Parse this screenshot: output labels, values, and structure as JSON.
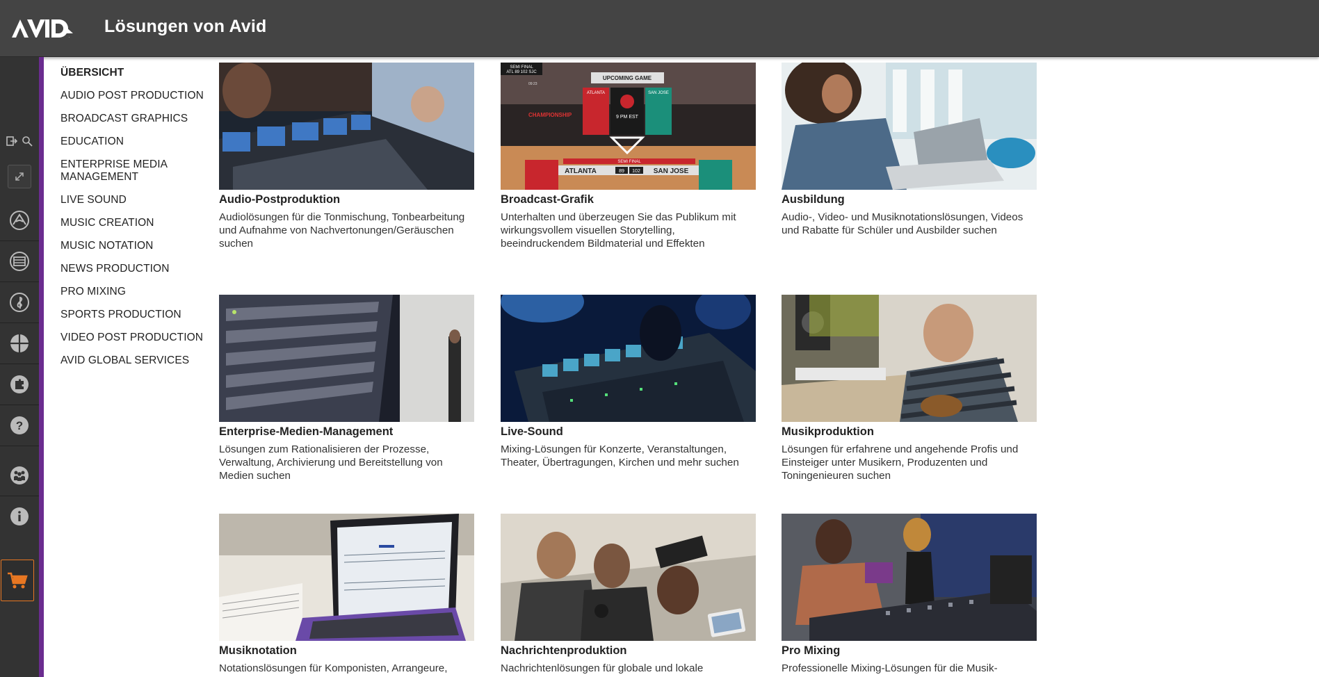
{
  "header": {
    "logo_text": "AVID",
    "title": "Lösungen von Avid"
  },
  "rail": {
    "tools": [
      "exit-icon",
      "search-icon"
    ],
    "expand_icon": "expand-icon",
    "items": [
      "avid-swoosh-icon",
      "film-icon",
      "treble-clef-icon",
      "globe-grid-icon",
      "puzzle-icon",
      "help-icon",
      "community-icon",
      "info-icon"
    ],
    "cart_icon": "cart-icon",
    "accent_color": "#6a2c8f",
    "cart_color": "#e87722"
  },
  "nav": {
    "items": [
      {
        "label": "ÜBERSICHT",
        "active": true
      },
      {
        "label": "AUDIO POST PRODUCTION"
      },
      {
        "label": "BROADCAST GRAPHICS"
      },
      {
        "label": "EDUCATION"
      },
      {
        "label": "ENTERPRISE MEDIA MANAGEMENT"
      },
      {
        "label": "LIVE SOUND"
      },
      {
        "label": "MUSIC CREATION"
      },
      {
        "label": "MUSIC NOTATION"
      },
      {
        "label": "NEWS PRODUCTION"
      },
      {
        "label": "PRO MIXING"
      },
      {
        "label": "SPORTS PRODUCTION"
      },
      {
        "label": "VIDEO POST PRODUCTION"
      },
      {
        "label": "AVID GLOBAL SERVICES"
      }
    ]
  },
  "cards": [
    {
      "title": "Audio-Postproduktion",
      "desc": "Audiolösungen für die Tonmischung, Tonbearbeitung und Aufnahme von Nachvertonungen/Geräuschen suchen"
    },
    {
      "title": "Broadcast-Grafik",
      "desc": "Unterhalten und überzeugen Sie das Publikum mit wirkungsvollem visuellen Storytelling, beeindruckendem Bildmaterial und Effekten",
      "graphic": {
        "top_left": "SEMI FINAL",
        "score_small": "ATL 89 102 SJC",
        "time_small": "09:23",
        "upcoming": "UPCOMING GAME",
        "team_left": "ATLANTA",
        "team_right": "SAN JOSE",
        "game_time": "9 PM EST",
        "banner": "CHAMPIONSHIP",
        "bottom_label": "SEMI FINAL",
        "bottom_left": "ATLANTA",
        "score_a": "89",
        "score_b": "102",
        "bottom_right": "SAN JOSE"
      }
    },
    {
      "title": "Ausbildung",
      "desc": "Audio-, Video- und Musiknotationslösungen, Videos und Rabatte für Schüler und Ausbilder suchen"
    },
    {
      "title": "Enterprise-Medien-Management",
      "desc": "Lösungen zum Rationalisieren der Prozesse, Verwaltung, Archivierung und Bereitstellung von Medien suchen"
    },
    {
      "title": "Live-Sound",
      "desc": "Mixing-Lösungen für Konzerte, Veranstaltungen, Theater, Übertragungen, Kirchen und mehr suchen"
    },
    {
      "title": "Musikproduktion",
      "desc": "Lösungen für erfahrene und angehende Profis und Einsteiger unter Musikern, Produzenten und Toningenieuren suchen"
    },
    {
      "title": "Musiknotation",
      "desc": "Notationslösungen für Komponisten, Arrangeure,"
    },
    {
      "title": "Nachrichtenproduktion",
      "desc": "Nachrichtenlösungen für globale und lokale"
    },
    {
      "title": "Pro Mixing",
      "desc": "Professionelle Mixing-Lösungen für die Musik-"
    }
  ]
}
